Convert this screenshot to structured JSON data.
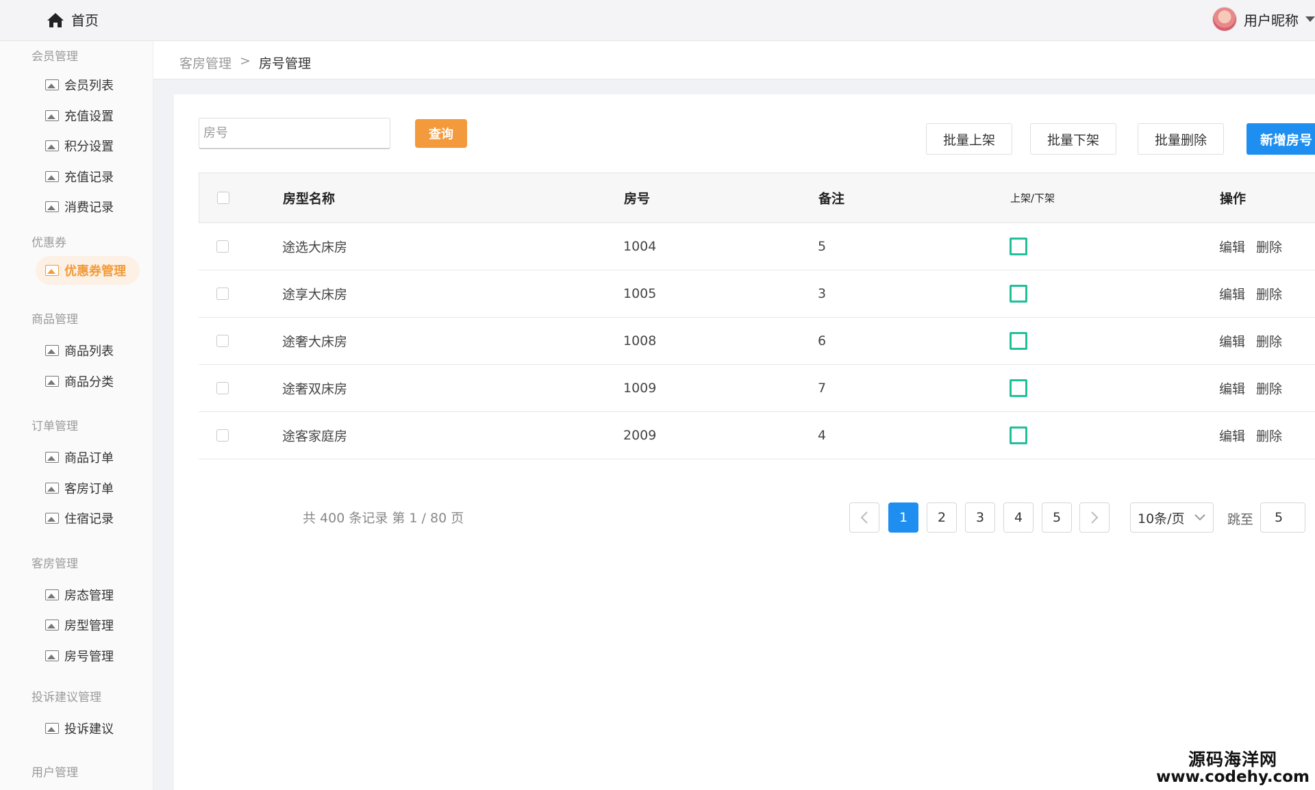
{
  "topbar": {
    "home_label": "首页",
    "user_name": "用户昵称"
  },
  "sidebar": {
    "groups": [
      {
        "title": "会员管理",
        "items": [
          "会员列表",
          "充值设置",
          "积分设置",
          "充值记录",
          "消费记录"
        ]
      },
      {
        "title": "优惠券",
        "items": [
          "优惠券管理"
        ]
      },
      {
        "title": "商品管理",
        "items": [
          "商品列表",
          "商品分类"
        ]
      },
      {
        "title": "订单管理",
        "items": [
          "商品订单",
          "客房订单",
          "住宿记录"
        ]
      },
      {
        "title": "客房管理",
        "items": [
          "房态管理",
          "房型管理",
          "房号管理"
        ]
      },
      {
        "title": "投诉建议管理",
        "items": [
          "投诉建议"
        ]
      },
      {
        "title": "用户管理",
        "items": []
      }
    ],
    "active_item": "优惠券管理"
  },
  "breadcrumb": {
    "parent": "客房管理",
    "separator": ">",
    "current": "房号管理"
  },
  "toolbar": {
    "search_placeholder": "房号",
    "query_label": "查询",
    "batch_on_label": "批量上架",
    "batch_off_label": "批量下架",
    "batch_delete_label": "批量删除",
    "add_label": "新增房号"
  },
  "table": {
    "headers": {
      "room_type": "房型名称",
      "room_no": "房号",
      "note": "备注",
      "shelf": "上架/下架",
      "actions": "操作"
    },
    "rows": [
      {
        "room_type": "途选大床房",
        "room_no": "1004",
        "note": "5",
        "edit": "编辑",
        "delete": "删除"
      },
      {
        "room_type": "途享大床房",
        "room_no": "1005",
        "note": "3",
        "edit": "编辑",
        "delete": "删除"
      },
      {
        "room_type": "途奢大床房",
        "room_no": "1008",
        "note": "6",
        "edit": "编辑",
        "delete": "删除"
      },
      {
        "room_type": "途奢双床房",
        "room_no": "1009",
        "note": "7",
        "edit": "编辑",
        "delete": "删除"
      },
      {
        "room_type": "途客家庭房",
        "room_no": "2009",
        "note": "4",
        "edit": "编辑",
        "delete": "删除"
      }
    ]
  },
  "pagination": {
    "summary": "共 400 条记录 第 1 / 80 页",
    "pages": [
      "1",
      "2",
      "3",
      "4",
      "5"
    ],
    "current_page": "1",
    "page_size": "10条/页",
    "jump_label": "跳至",
    "jump_value": "5"
  },
  "watermark": {
    "line1": "源码海洋网",
    "line2": "www.codehy.com"
  },
  "colors": {
    "accent_orange": "#f39a3c",
    "primary_blue": "#1e8ff0",
    "shelf_green": "#1fbf9b"
  }
}
